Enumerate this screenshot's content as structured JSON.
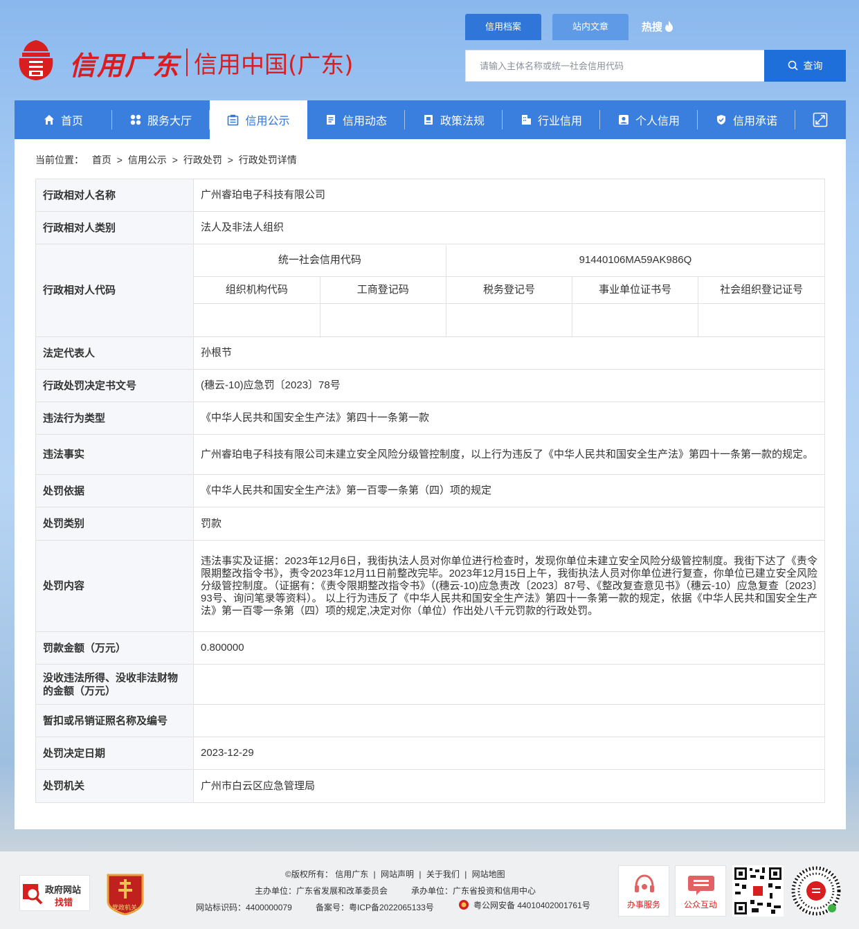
{
  "header": {
    "logo_script_text": "信用广东",
    "logo_plain_text": "信用中国(广东)",
    "tabs": [
      "信用档案",
      "站内文章"
    ],
    "hot_label": "热搜",
    "search_placeholder": "请输入主体名称或统一社会信用代码",
    "search_button": "查询"
  },
  "nav": {
    "items": [
      {
        "label": "首页",
        "icon": "home-icon"
      },
      {
        "label": "服务大厅",
        "icon": "grid-icon"
      },
      {
        "label": "信用公示",
        "icon": "notice-icon"
      },
      {
        "label": "信用动态",
        "icon": "news-icon"
      },
      {
        "label": "政策法规",
        "icon": "policy-icon"
      },
      {
        "label": "行业信用",
        "icon": "building-icon"
      },
      {
        "label": "个人信用",
        "icon": "person-icon"
      },
      {
        "label": "信用承诺",
        "icon": "shield-icon"
      }
    ],
    "active_index": 2
  },
  "breadcrumb": {
    "label": "当前位置：",
    "items": [
      "首页",
      "信用公示",
      "行政处罚",
      "行政处罚详情"
    ],
    "separator": ">"
  },
  "detail": {
    "name_label": "行政相对人名称",
    "name_value": "广州睿珀电子科技有限公司",
    "type_label": "行政相对人类别",
    "type_value": "法人及非法人组织",
    "code_label": "行政相对人代码",
    "codes": {
      "uscc_label": "统一社会信用代码",
      "uscc_value": "91440106MA59AK986Q",
      "sub_headers": [
        "组织机构代码",
        "工商登记码",
        "税务登记号",
        "事业单位证书号",
        "社会组织登记证号"
      ],
      "sub_values": [
        "",
        "",
        "",
        "",
        ""
      ]
    },
    "legal_rep_label": "法定代表人",
    "legal_rep_value": "孙根节",
    "doc_no_label": "行政处罚决定书文号",
    "doc_no_value": "(穗云-10)应急罚〔2023〕78号",
    "violation_type_label": "违法行为类型",
    "violation_type_value": "《中华人民共和国安全生产法》第四十一条第一款",
    "facts_label": "违法事实",
    "facts_value": "广州睿珀电子科技有限公司未建立安全风险分级管控制度，以上行为违反了《中华人民共和国安全生产法》第四十一条第一款的规定。",
    "basis_label": "处罚依据",
    "basis_value": "《中华人民共和国安全生产法》第一百零一条第（四）项的规定",
    "category_label": "处罚类别",
    "category_value": "罚款",
    "content_label": "处罚内容",
    "content_value": "违法事实及证据：2023年12月6日，我街执法人员对你单位进行检查时，发现你单位未建立安全风险分级管控制度。我街下达了《责令限期整改指令书》，责令2023年12月11日前整改完毕。2023年12月15日上午，我街执法人员对你单位进行复查，你单位已建立安全风险分级管控制度。（证据有：《责令限期整改指令书》（(穗云-10)应急责改〔2023〕87号、《整改复查意见书》（穗云-10）应急复查〔2023〕93号、询问笔录等资料）。 以上行为违反了《中华人民共和国安全生产法》第四十一条第一款的规定，依据《中华人民共和国安全生产法》第一百零一条第（四）项的规定,决定对你（单位）作出处八千元罚款的行政处罚。",
    "fine_label": "罚款金额（万元）",
    "fine_value": "0.800000",
    "confiscation_label": "没收违法所得、没收非法财物的金额（万元）",
    "confiscation_value": "",
    "license_label": "暂扣或吊销证照名称及编号",
    "license_value": "",
    "date_label": "处罚决定日期",
    "date_value": "2023-12-29",
    "authority_label": "处罚机关",
    "authority_value": "广州市白云区应急管理局"
  },
  "footer": {
    "gov_site_title": "政府网站",
    "gov_site_sub": "找错",
    "party_badge_text": "党政机关",
    "links": [
      "©版权所有：",
      "信用广东",
      "网站声明",
      "关于我们",
      "网站地图"
    ],
    "sponsor": "主办单位：广东省发展和改革委员会",
    "organizer": "承办单位：广东省投资和信用中心",
    "site_id": "网站标识码：4400000079",
    "icp": "备案号：粤ICP备2022065133号",
    "police": "粤公网安备 44010402001761号",
    "service_tile": "办事服务",
    "interact_tile": "公众互动"
  },
  "colors": {
    "brand_red": "#d81e1e",
    "nav_blue": "#3a7fde",
    "button_blue": "#1f6fdb"
  }
}
